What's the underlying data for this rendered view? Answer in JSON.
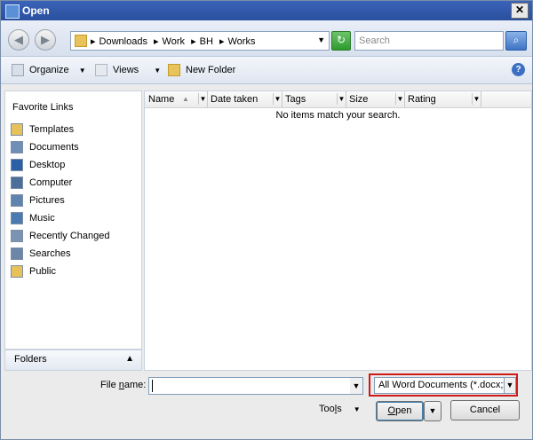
{
  "window": {
    "title": "Open",
    "close_glyph": "✕"
  },
  "address": {
    "crumbs": [
      "Downloads",
      "Work",
      "BH",
      "Works"
    ],
    "separator": "▸",
    "search_placeholder": "Search"
  },
  "toolbar": {
    "organize": "Organize",
    "views": "Views",
    "new_folder": "New Folder",
    "help_glyph": "?"
  },
  "nav": {
    "header": "Favorite Links",
    "items": [
      {
        "label": "Templates",
        "icon": "folder-icon",
        "color": "#e7c15a"
      },
      {
        "label": "Documents",
        "icon": "documents-icon",
        "color": "#6f8fb8"
      },
      {
        "label": "Desktop",
        "icon": "desktop-icon",
        "color": "#2b5fa6"
      },
      {
        "label": "Computer",
        "icon": "computer-icon",
        "color": "#4b6f9a"
      },
      {
        "label": "Pictures",
        "icon": "pictures-icon",
        "color": "#5f84b0"
      },
      {
        "label": "Music",
        "icon": "music-icon",
        "color": "#4a7ab0"
      },
      {
        "label": "Recently Changed",
        "icon": "recent-icon",
        "color": "#7a93b3"
      },
      {
        "label": "Searches",
        "icon": "searches-icon",
        "color": "#6a86a8"
      },
      {
        "label": "Public",
        "icon": "folder-icon",
        "color": "#e7c15a"
      }
    ],
    "folders_label": "Folders"
  },
  "columns": [
    "Name",
    "Date taken",
    "Tags",
    "Size",
    "Rating"
  ],
  "empty_message": "No items match your search.",
  "bottom": {
    "filename_label_pre": "File ",
    "filename_label_u": "n",
    "filename_label_post": "ame:",
    "filename_value": "",
    "filter_value": "All Word Documents (*.docx;*",
    "tools_pre": "Too",
    "tools_u": "l",
    "tools_post": "s",
    "open_u": "O",
    "open_post": "pen",
    "cancel": "Cancel"
  },
  "colors": {
    "highlight_border": "#d01818"
  }
}
